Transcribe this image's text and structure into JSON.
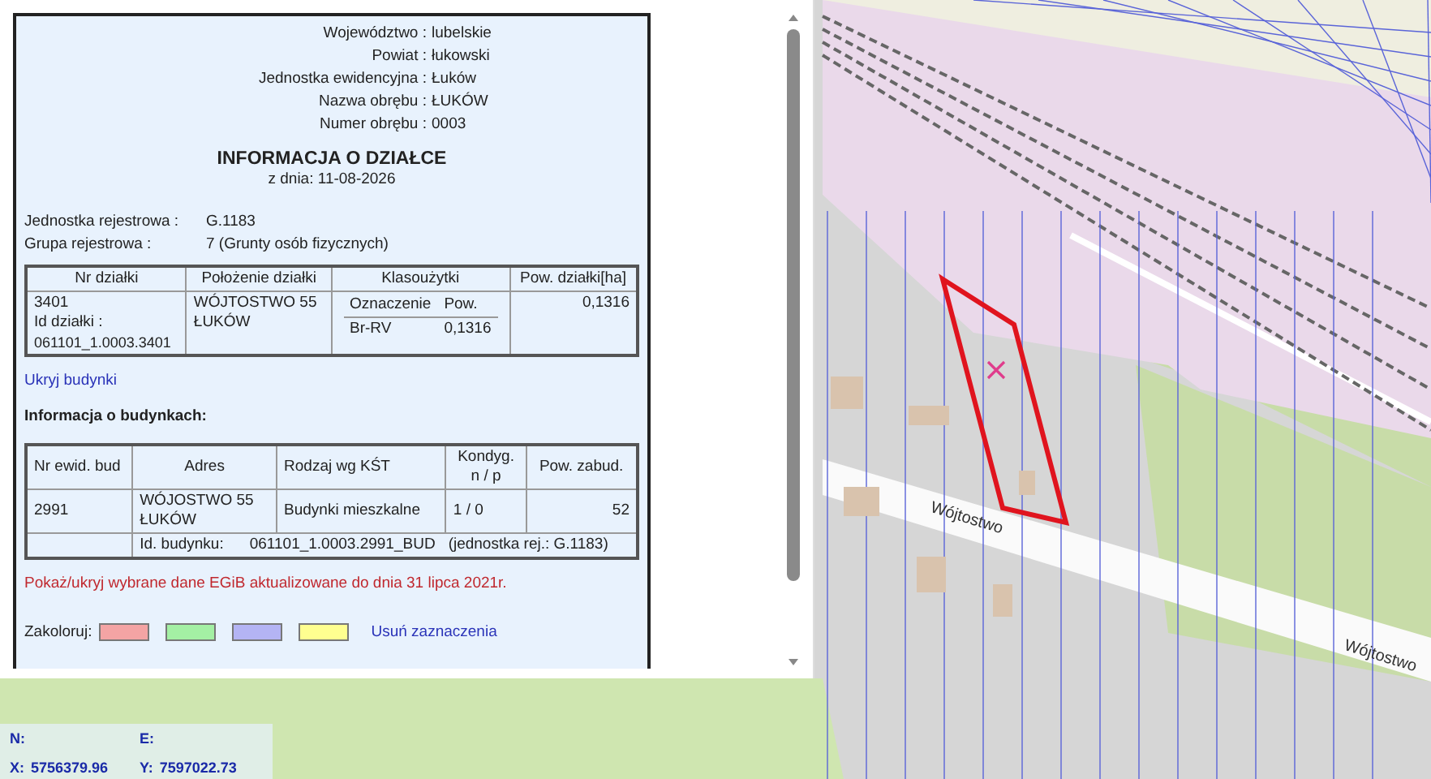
{
  "info_panel": {
    "header_lines": [
      {
        "label": "Województwo :",
        "value": "lubelskie"
      },
      {
        "label": "Powiat :",
        "value": "łukowski"
      },
      {
        "label": "Jednostka ewidencyjna :",
        "value": "Łuków"
      },
      {
        "label": "Nazwa obrębu :",
        "value": "ŁUKÓW"
      },
      {
        "label": "Numer obrębu :",
        "value": "0003"
      }
    ],
    "title": "INFORMACJA O DZIAŁCE",
    "date_line": "z dnia: 11-08-2026",
    "registry": [
      {
        "label": "Jednostka rejestrowa :",
        "value": "G.1183"
      },
      {
        "label": "Grupa rejestrowa :",
        "value": "7 (Grunty osób fizycznych)"
      }
    ],
    "parcel_table": {
      "columns": [
        "Nr działki",
        "Położenie działki",
        "Klasoużytki",
        "Pow. działki[ha]"
      ],
      "sub_columns": [
        "Oznaczenie",
        "Pow."
      ],
      "row": {
        "number": "3401",
        "id_label": "Id działki :",
        "id": "061101_1.0003.3401",
        "location": [
          "WÓJTOSTWO 55",
          "ŁUKÓW"
        ],
        "classes": [
          [
            "Br-RV",
            "0,1316"
          ]
        ],
        "area": "0,1316"
      }
    },
    "hide_buildings_link": "Ukryj budynki",
    "buildings_heading": "Informacja o budynkach:",
    "buildings_table": {
      "columns": [
        [
          "Nr ewid. bud"
        ],
        [
          "Adres"
        ],
        [
          "Rodzaj wg KŚT"
        ],
        [
          "Kondyg.",
          "n / p"
        ],
        [
          "Pow. zabud."
        ]
      ],
      "rows": [
        {
          "number": "2991",
          "address": [
            "WÓJOSTWO 55",
            "ŁUKÓW"
          ],
          "type": "Budynki mieszkalne",
          "storeys": "1 / 0",
          "area": "52",
          "id_label": "Id. budynku:",
          "id": "061101_1.0003.2991_BUD",
          "unit": "(jednostka rej.: G.1183)"
        }
      ]
    },
    "notice": "Pokaż/ukryj wybrane dane EGiB aktualizowane do dnia 31 lipca 2021r.",
    "color_picker": {
      "label": "Zakoloruj:",
      "swatches": [
        {
          "color": "#f4a4a4"
        },
        {
          "color": "#a4f0a4"
        },
        {
          "color": "#b4b4f4"
        },
        {
          "color": "#ffff90"
        }
      ],
      "clear_link": "Usuń zaznaczenia"
    }
  },
  "map": {
    "street_labels": [
      "Wójtostwo",
      "Wójtostwo"
    ]
  },
  "coordinates": [
    {
      "label": "N:"
    },
    {
      "label": "E:"
    },
    {
      "label": "X:",
      "value": "5756379.96"
    },
    {
      "label": "Y:",
      "value": "7597022.73"
    }
  ]
}
